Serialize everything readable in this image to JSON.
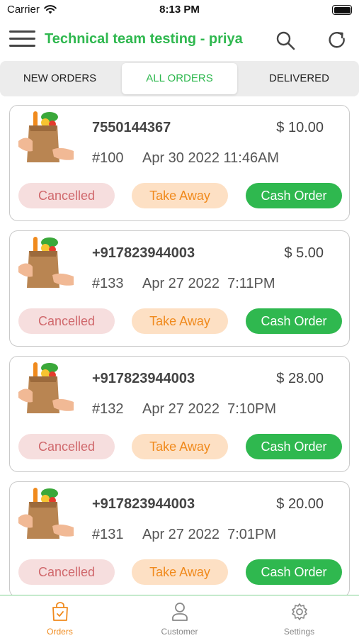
{
  "status_bar": {
    "carrier": "Carrier",
    "time": "8:13 PM"
  },
  "header": {
    "title": "Technical team testing - priya"
  },
  "tabs": [
    {
      "label": "NEW ORDERS",
      "active": false
    },
    {
      "label": "ALL ORDERS",
      "active": true
    },
    {
      "label": "DELIVERED",
      "active": false
    }
  ],
  "orders": [
    {
      "phone": "7550144367",
      "amount": "$ 10.00",
      "id": "#100",
      "date": "Apr 30 2022 11:46AM",
      "status": "Cancelled",
      "type": "Take Away",
      "payment": "Cash Order"
    },
    {
      "phone": "+917823944003",
      "amount": "$ 5.00",
      "id": "#133",
      "date": "Apr 27 2022  7:11PM",
      "status": "Cancelled",
      "type": "Take Away",
      "payment": "Cash Order"
    },
    {
      "phone": "+917823944003",
      "amount": "$ 28.00",
      "id": "#132",
      "date": "Apr 27 2022  7:10PM",
      "status": "Cancelled",
      "type": "Take Away",
      "payment": "Cash Order"
    },
    {
      "phone": "+917823944003",
      "amount": "$ 20.00",
      "id": "#131",
      "date": "Apr 27 2022  7:01PM",
      "status": "Cancelled",
      "type": "Take Away",
      "payment": "Cash Order"
    }
  ],
  "bottom_nav": [
    {
      "label": "Orders",
      "icon": "orders-bag-icon",
      "active": true
    },
    {
      "label": "Customer",
      "icon": "customer-person-icon",
      "active": false
    },
    {
      "label": "Settings",
      "icon": "settings-gear-icon",
      "active": false
    }
  ],
  "colors": {
    "brand_green": "#2fb84f",
    "accent_orange": "#f08a1d",
    "cancelled_red": "#d0686c"
  }
}
